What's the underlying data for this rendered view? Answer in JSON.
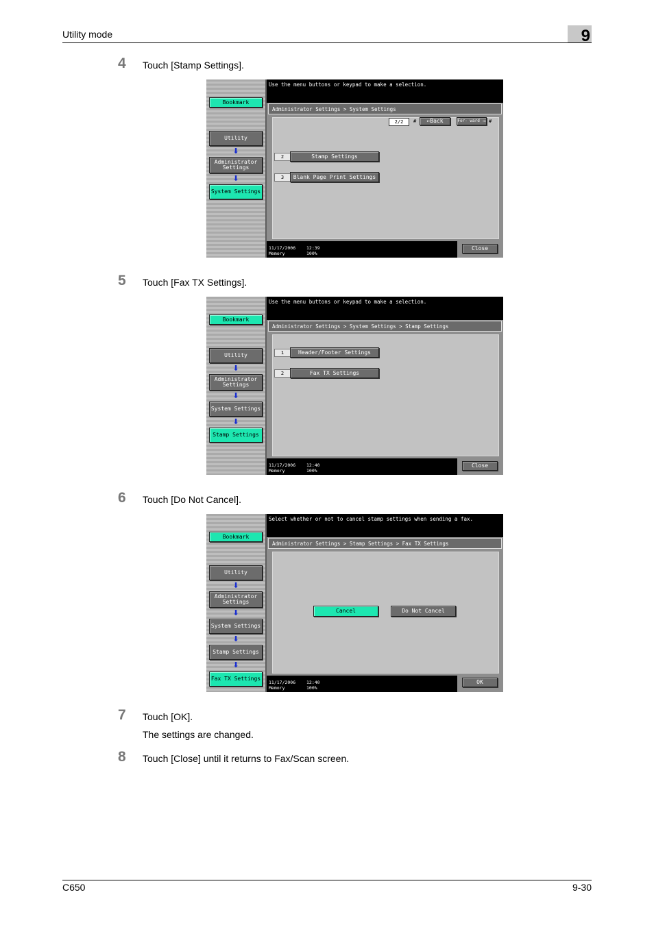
{
  "header": {
    "section_title": "Utility mode",
    "chapter_number": "9"
  },
  "footer": {
    "model": "C650",
    "page": "9-30"
  },
  "steps": [
    {
      "number": "4",
      "text": "Touch [Stamp Settings]."
    },
    {
      "number": "5",
      "text": "Touch [Fax TX Settings]."
    },
    {
      "number": "6",
      "text": "Touch [Do Not Cancel]."
    },
    {
      "number": "7",
      "text": "Touch [OK].",
      "result": "The settings are changed."
    },
    {
      "number": "8",
      "text": "Touch [Close] until it returns to Fax/Scan screen."
    }
  ],
  "screens": [
    {
      "message": "Use the menu buttons or keypad to make a selection.",
      "breadcrumb": "Administrator Settings > System Settings",
      "sidebar": [
        "Bookmark",
        "Utility",
        "Administrator Settings",
        "System Settings"
      ],
      "pager": {
        "page": "2/2",
        "back": "Back",
        "forward": "For- ward",
        "hash": "#"
      },
      "items": [
        {
          "num": "2",
          "label": "Stamp Settings"
        },
        {
          "num": "3",
          "label": "Blank Page Print Settings"
        }
      ],
      "status": {
        "date": "11/17/2006",
        "time": "12:39",
        "memory_label": "Memory",
        "memory": "100%"
      },
      "action": "Close"
    },
    {
      "message": "Use the menu buttons or keypad to make a selection.",
      "breadcrumb": "Administrator Settings > System Settings > Stamp Settings",
      "sidebar": [
        "Bookmark",
        "Utility",
        "Administrator Settings",
        "System Settings",
        "Stamp Settings"
      ],
      "items": [
        {
          "num": "1",
          "label": "Header/Footer Settings"
        },
        {
          "num": "2",
          "label": "Fax TX Settings"
        }
      ],
      "status": {
        "date": "11/17/2006",
        "time": "12:40",
        "memory_label": "Memory",
        "memory": "100%"
      },
      "action": "Close"
    },
    {
      "message": "Select whether or not to cancel stamp settings when sending a fax.",
      "breadcrumb": "Administrator Settings > Stamp Settings > Fax TX Settings",
      "sidebar": [
        "Bookmark",
        "Utility",
        "Administrator Settings",
        "System Settings",
        "Stamp Settings",
        "Fax TX Settings"
      ],
      "options": {
        "cancel": "Cancel",
        "do_not_cancel": "Do Not Cancel",
        "selected": "Cancel"
      },
      "status": {
        "date": "11/17/2006",
        "time": "12:40",
        "memory_label": "Memory",
        "memory": "100%"
      },
      "action": "OK"
    }
  ],
  "colors": {
    "selected_green": "#1de6b0",
    "nav_arrow": "#1a2fd0"
  }
}
